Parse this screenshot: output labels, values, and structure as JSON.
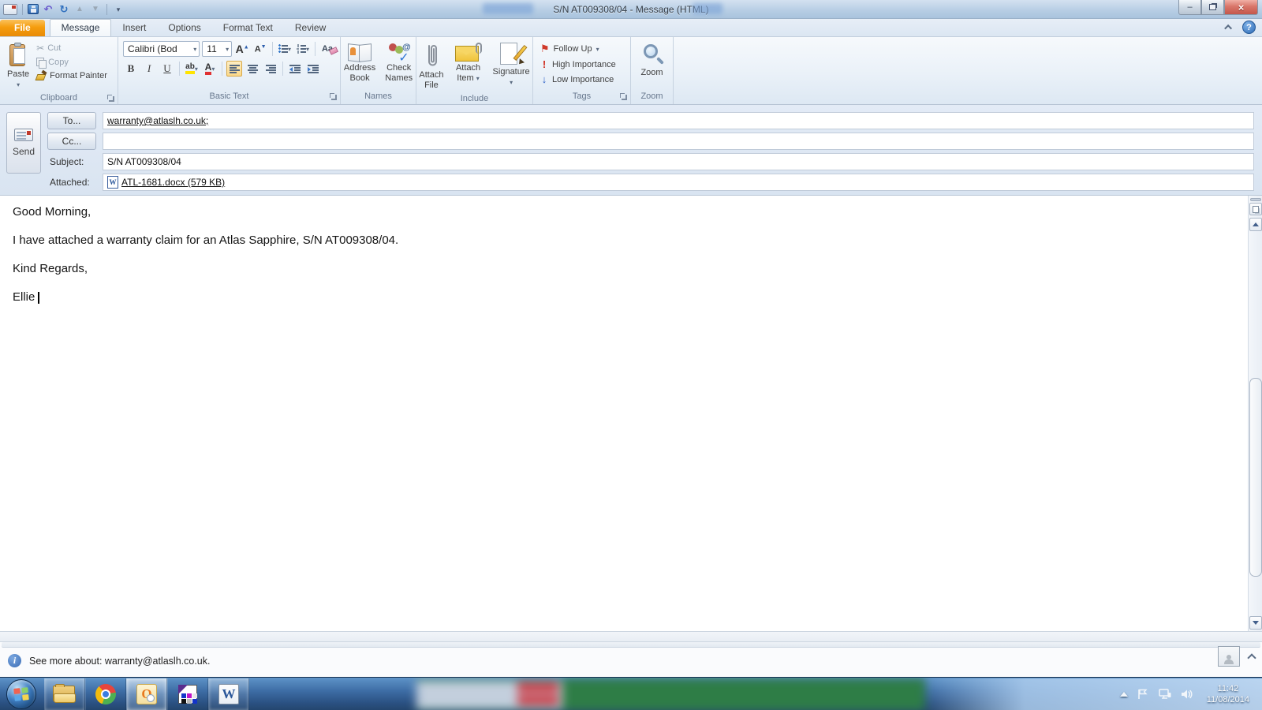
{
  "window": {
    "title": "S/N AT009308/04  -  Message (HTML)"
  },
  "tabs": {
    "items": [
      "File",
      "Message",
      "Insert",
      "Options",
      "Format Text",
      "Review"
    ],
    "active": "Message"
  },
  "ribbon": {
    "clipboard": {
      "label": "Clipboard",
      "paste": "Paste",
      "cut": "Cut",
      "copy": "Copy",
      "format_painter": "Format Painter"
    },
    "basic_text": {
      "label": "Basic Text",
      "font_name": "Calibri (Bod",
      "font_size": "11",
      "bold": "B",
      "italic": "I",
      "underline": "U",
      "grow_font": "A",
      "shrink_font": "A",
      "highlight": "ab",
      "font_color": "A",
      "clear_format": "Aa"
    },
    "names": {
      "label": "Names",
      "address_book": [
        "Address",
        "Book"
      ],
      "check_names": [
        "Check",
        "Names"
      ]
    },
    "include": {
      "label": "Include",
      "attach_file": [
        "Attach",
        "File"
      ],
      "attach_item": [
        "Attach",
        "Item"
      ],
      "signature": "Signature"
    },
    "tags": {
      "label": "Tags",
      "follow_up": "Follow Up",
      "high_importance": "High Importance",
      "low_importance": "Low Importance"
    },
    "zoom_group": {
      "label": "Zoom",
      "zoom": "Zoom"
    }
  },
  "glyphs": {
    "cut": "✂",
    "undo": "↶",
    "redo": "↻",
    "prev": "▲",
    "next": "▼",
    "dropdown": "▾",
    "flag": "⚑",
    "high": "!",
    "low": "↓",
    "help": "?",
    "info": "i",
    "minimize": "–",
    "close": "×",
    "at": "@",
    "tick": "✓"
  },
  "header": {
    "send": "Send",
    "to_button": "To...",
    "to_value": "warranty@atlaslh.co.uk;",
    "cc_button": "Cc...",
    "cc_value": "",
    "subject_label": "Subject:",
    "subject_value": "S/N AT009308/04",
    "attached_label": "Attached:",
    "attachment_name": "ATL-1681.docx (579 KB)",
    "word_icon_letter": "W"
  },
  "body": {
    "lines": [
      "Good Morning,",
      "I have attached a warranty claim for an Atlas Sapphire, S/N AT009308/04.",
      "Kind Regards,",
      "Ellie"
    ]
  },
  "statusbar": {
    "text": "See more about: warranty@atlaslh.co.uk."
  },
  "taskbar": {
    "time": "11:42",
    "date": "11/08/2014",
    "outlook_letter": "O",
    "word_letter": "W"
  }
}
